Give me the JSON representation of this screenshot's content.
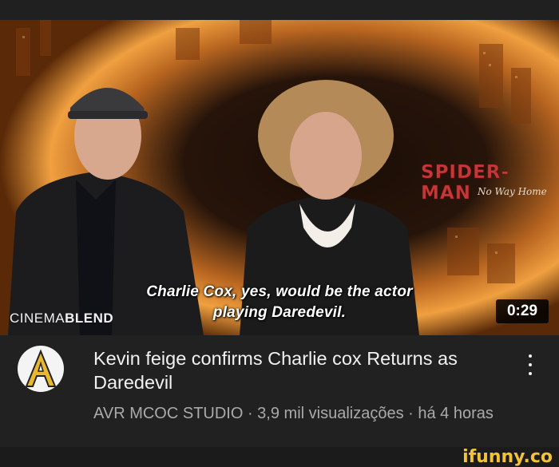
{
  "video": {
    "subtitle_line1": "Charlie Cox, yes, would be the actor",
    "subtitle_line2": "playing Daredevil.",
    "source_logo_light": "CINEMA",
    "source_logo_bold": "BLEND",
    "duration": "0:29",
    "poster_title": "SPIDER-MAN",
    "poster_subtitle": "No Way Home"
  },
  "info": {
    "channel_avatar_letter": "A",
    "title": "Kevin feige confirms Charlie cox Returns as Daredevil",
    "meta": "AVR MCOC STUDIO · 3,9 mil visualizações · há 4 horas"
  },
  "watermark": "ifunny.co",
  "colors": {
    "background": "#212121",
    "title_text": "#f1f1f1",
    "meta_text": "#aaaaaa",
    "watermark": "#f2c23a",
    "avatar_accent": "#e8b92f"
  }
}
